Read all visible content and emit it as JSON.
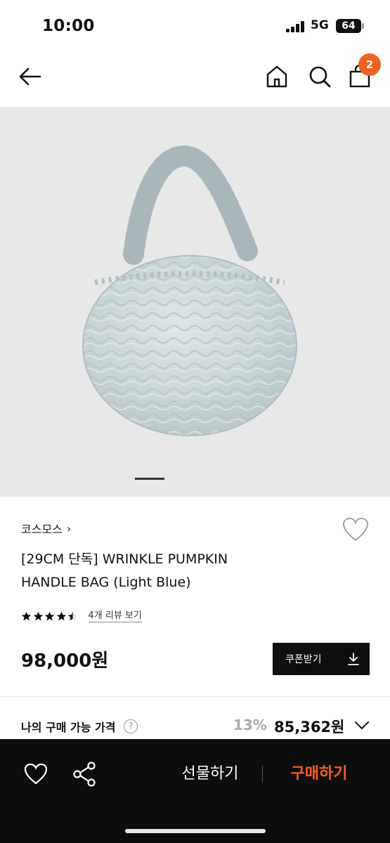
{
  "status_bar": {
    "time": "10:00",
    "network": "5G",
    "battery": "64"
  },
  "nav": {
    "cart_badge": "2",
    "icons": [
      "back-arrow-icon",
      "home-icon",
      "search-icon",
      "cart-icon"
    ]
  },
  "product": {
    "image_colors": {
      "background": "#e8e8e8",
      "bag": "#cdd8da"
    },
    "carousel_position": "1",
    "brand": "코스모스",
    "title_line1": "[29CM 단독] WRINKLE PUMPKIN",
    "title_line2": "HANDLE BAG (Light Blue)",
    "rating": 4.5,
    "review_link": "4개 리뷰 보기",
    "price": "98,000원",
    "coupon_button": "쿠폰받기"
  },
  "my_price": {
    "label": "나의 구매 가능 가격",
    "help": "?",
    "discount": "13%",
    "value": "85,362원"
  },
  "bottom_bar": {
    "gift": "선물하기",
    "buy": "구매하기",
    "buy_color": "#ff5a1f"
  }
}
